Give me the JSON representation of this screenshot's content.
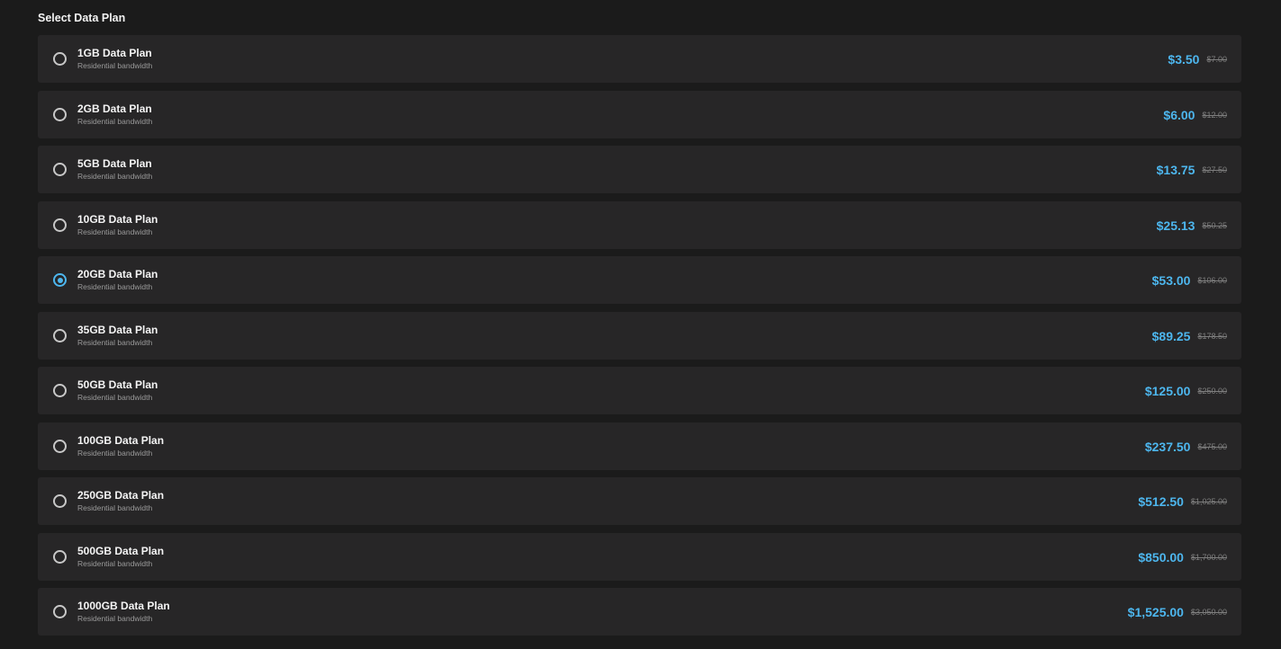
{
  "section_title": "Select Data Plan",
  "accent_color": "#4db6ee",
  "plans": [
    {
      "name": "1GB Data Plan",
      "subtitle": "Residential bandwidth",
      "price": "$3.50",
      "old_price": "$7.00",
      "selected": false
    },
    {
      "name": "2GB Data Plan",
      "subtitle": "Residential bandwidth",
      "price": "$6.00",
      "old_price": "$12.00",
      "selected": false
    },
    {
      "name": "5GB Data Plan",
      "subtitle": "Residential bandwidth",
      "price": "$13.75",
      "old_price": "$27.50",
      "selected": false
    },
    {
      "name": "10GB Data Plan",
      "subtitle": "Residential bandwidth",
      "price": "$25.13",
      "old_price": "$50.25",
      "selected": false
    },
    {
      "name": "20GB Data Plan",
      "subtitle": "Residential bandwidth",
      "price": "$53.00",
      "old_price": "$106.00",
      "selected": true
    },
    {
      "name": "35GB Data Plan",
      "subtitle": "Residential bandwidth",
      "price": "$89.25",
      "old_price": "$178.50",
      "selected": false
    },
    {
      "name": "50GB Data Plan",
      "subtitle": "Residential bandwidth",
      "price": "$125.00",
      "old_price": "$250.00",
      "selected": false
    },
    {
      "name": "100GB Data Plan",
      "subtitle": "Residential bandwidth",
      "price": "$237.50",
      "old_price": "$475.00",
      "selected": false
    },
    {
      "name": "250GB Data Plan",
      "subtitle": "Residential bandwidth",
      "price": "$512.50",
      "old_price": "$1,025.00",
      "selected": false
    },
    {
      "name": "500GB Data Plan",
      "subtitle": "Residential bandwidth",
      "price": "$850.00",
      "old_price": "$1,700.00",
      "selected": false
    },
    {
      "name": "1000GB Data Plan",
      "subtitle": "Residential bandwidth",
      "price": "$1,525.00",
      "old_price": "$3,050.00",
      "selected": false
    }
  ]
}
